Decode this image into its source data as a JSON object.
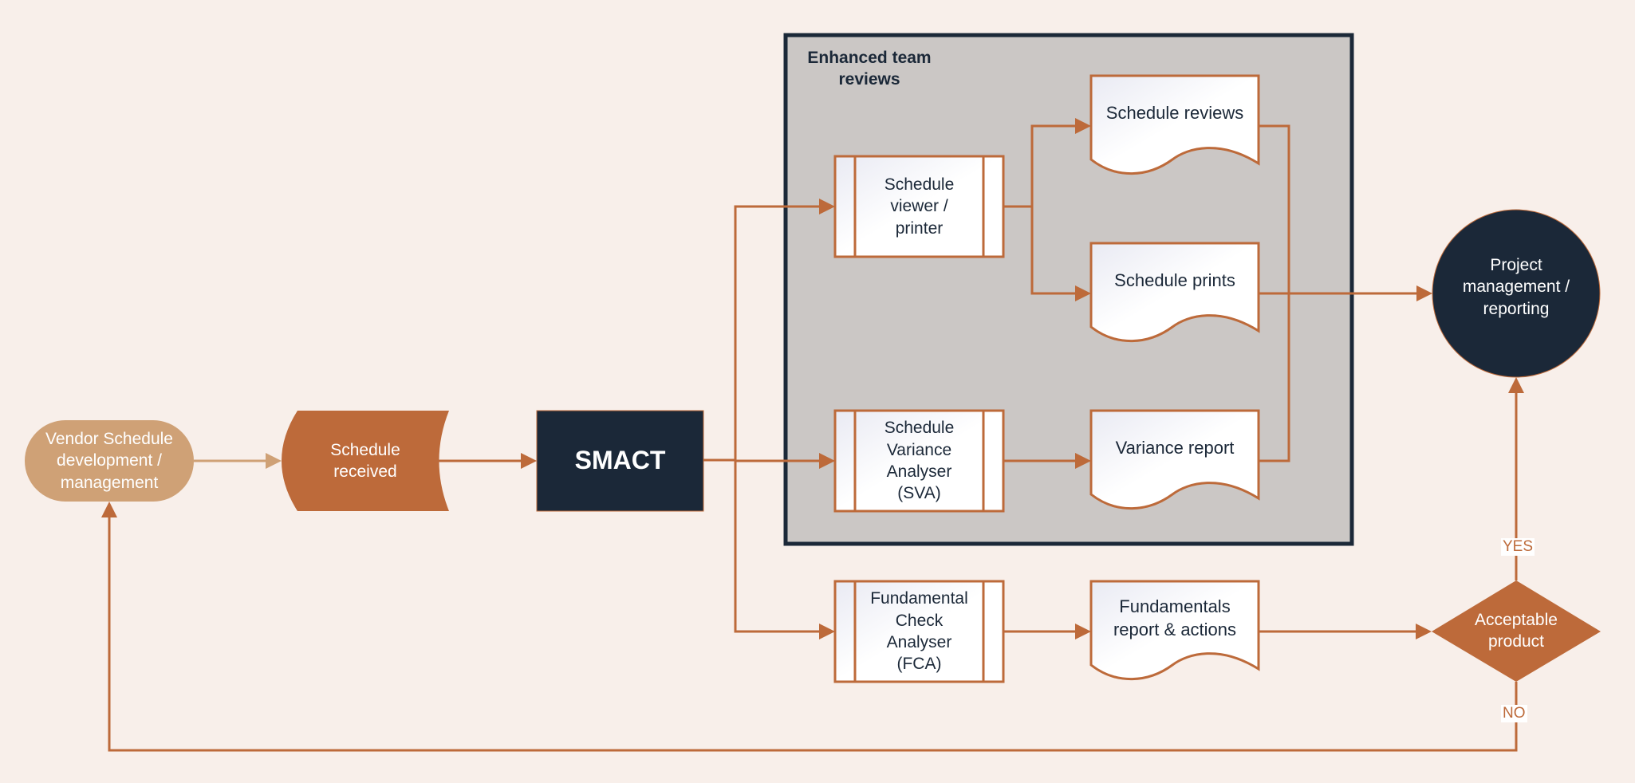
{
  "colors": {
    "background": "#f8efea",
    "accent": "#bd6a3a",
    "accent_light": "#cfa176",
    "navy": "#1b2838",
    "group_fill": "#cbc7c5",
    "doc_fill": "#f6f6fb"
  },
  "nodes": {
    "vendor": {
      "label": "Vendor Schedule\ndevelopment /\nmanagement",
      "shape": "terminator"
    },
    "received": {
      "label": "Schedule\nreceived",
      "shape": "stored-data"
    },
    "smact": {
      "label": "SMACT",
      "shape": "process"
    },
    "viewer": {
      "label": "Schedule\nviewer /\nprinter",
      "shape": "predefined-process"
    },
    "reviews": {
      "label": "Schedule reviews",
      "shape": "document"
    },
    "prints": {
      "label": "Schedule prints",
      "shape": "document"
    },
    "sva": {
      "label": "Schedule\nVariance\nAnalyser\n(SVA)",
      "shape": "predefined-process"
    },
    "variance": {
      "label": "Variance report",
      "shape": "document"
    },
    "fca": {
      "label": "Fundamental\nCheck\nAnalyser\n(FCA)",
      "shape": "predefined-process"
    },
    "fundamentals": {
      "label": "Fundamentals\nreport & actions",
      "shape": "document"
    },
    "pm": {
      "label": "Project\nmanagement /\nreporting",
      "shape": "circle"
    },
    "decision": {
      "label": "Acceptable\nproduct",
      "shape": "decision"
    }
  },
  "group": {
    "label": "Enhanced team\nreviews"
  },
  "edges": [
    {
      "from": "vendor",
      "to": "received"
    },
    {
      "from": "received",
      "to": "smact"
    },
    {
      "from": "smact",
      "to": "viewer"
    },
    {
      "from": "smact",
      "to": "sva"
    },
    {
      "from": "smact",
      "to": "fca"
    },
    {
      "from": "viewer",
      "to": "reviews"
    },
    {
      "from": "viewer",
      "to": "prints"
    },
    {
      "from": "sva",
      "to": "variance"
    },
    {
      "from": "reviews",
      "to": "pm"
    },
    {
      "from": "prints",
      "to": "pm"
    },
    {
      "from": "variance",
      "to": "pm"
    },
    {
      "from": "fca",
      "to": "fundamentals"
    },
    {
      "from": "fundamentals",
      "to": "decision"
    },
    {
      "from": "decision",
      "to": "pm",
      "label": "YES"
    },
    {
      "from": "decision",
      "to": "vendor",
      "label": "NO"
    }
  ],
  "edge_labels": {
    "yes": "YES",
    "no": "NO"
  }
}
